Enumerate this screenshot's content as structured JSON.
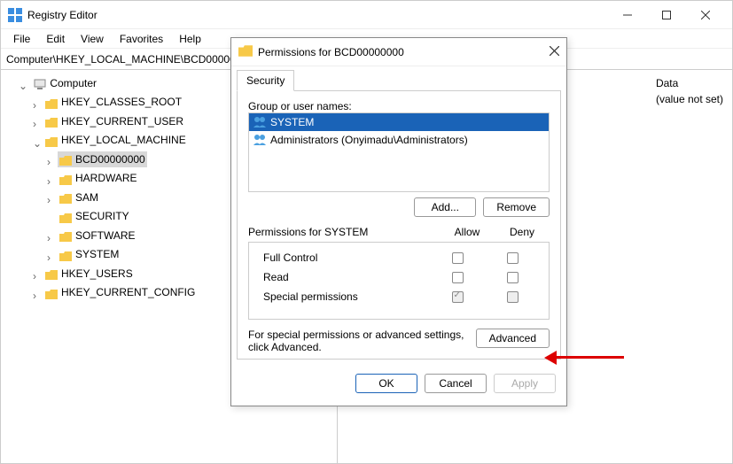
{
  "app": {
    "title": "Registry Editor"
  },
  "menu": {
    "file": "File",
    "edit": "Edit",
    "view": "View",
    "favorites": "Favorites",
    "help": "Help"
  },
  "address": "Computer\\HKEY_LOCAL_MACHINE\\BCD00000000",
  "tree": {
    "root": "Computer",
    "hkcr": "HKEY_CLASSES_ROOT",
    "hkcu": "HKEY_CURRENT_USER",
    "hklm": "HKEY_LOCAL_MACHINE",
    "bcd": "BCD00000000",
    "hardware": "HARDWARE",
    "sam": "SAM",
    "security": "SECURITY",
    "software": "SOFTWARE",
    "system": "SYSTEM",
    "hku": "HKEY_USERS",
    "hkcc": "HKEY_CURRENT_CONFIG"
  },
  "datacols": {
    "data_header": "Data",
    "data_value": "(value not set)"
  },
  "dialog": {
    "title": "Permissions for BCD00000000",
    "tab_security": "Security",
    "group_label": "Group or user names:",
    "system": "SYSTEM",
    "admins": "Administrators (Onyimadu\\Administrators)",
    "add": "Add...",
    "remove": "Remove",
    "perm_label": "Permissions for SYSTEM",
    "allow": "Allow",
    "deny": "Deny",
    "full_control": "Full Control",
    "read": "Read",
    "special": "Special permissions",
    "help_text": "For special permissions or advanced settings, click Advanced.",
    "advanced": "Advanced",
    "ok": "OK",
    "cancel": "Cancel",
    "apply": "Apply"
  }
}
